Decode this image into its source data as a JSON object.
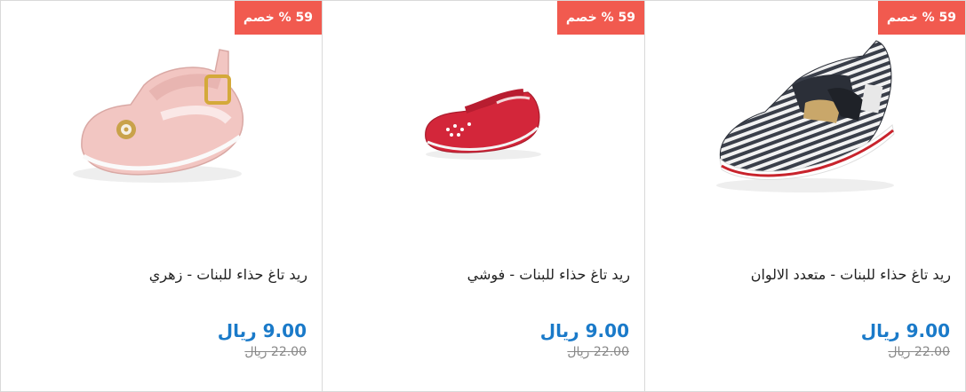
{
  "products": [
    {
      "badge": "59 % خصم",
      "title": "ريد تاغ حذاء للبنات - زهري",
      "price_value": "9.00",
      "price_currency": "ريال",
      "old_price_value": "22.00",
      "old_price_currency": "ريال",
      "image_icon": "pink-baby-shoe-icon"
    },
    {
      "badge": "59 % خصم",
      "title": "ريد تاغ حذاء للبنات - فوشي",
      "price_value": "9.00",
      "price_currency": "ريال",
      "old_price_value": "22.00",
      "old_price_currency": "ريال",
      "image_icon": "red-baby-shoe-icon"
    },
    {
      "badge": "59 % خصم",
      "title": "ريد تاغ حذاء للبنات - متعدد الالوان",
      "price_value": "9.00",
      "price_currency": "ريال",
      "old_price_value": "22.00",
      "old_price_currency": "ريال",
      "image_icon": "striped-baby-sneaker-icon"
    }
  ],
  "colors": {
    "badge": "#f15a4f",
    "price": "#1a7ac9",
    "old_price": "#888888"
  }
}
